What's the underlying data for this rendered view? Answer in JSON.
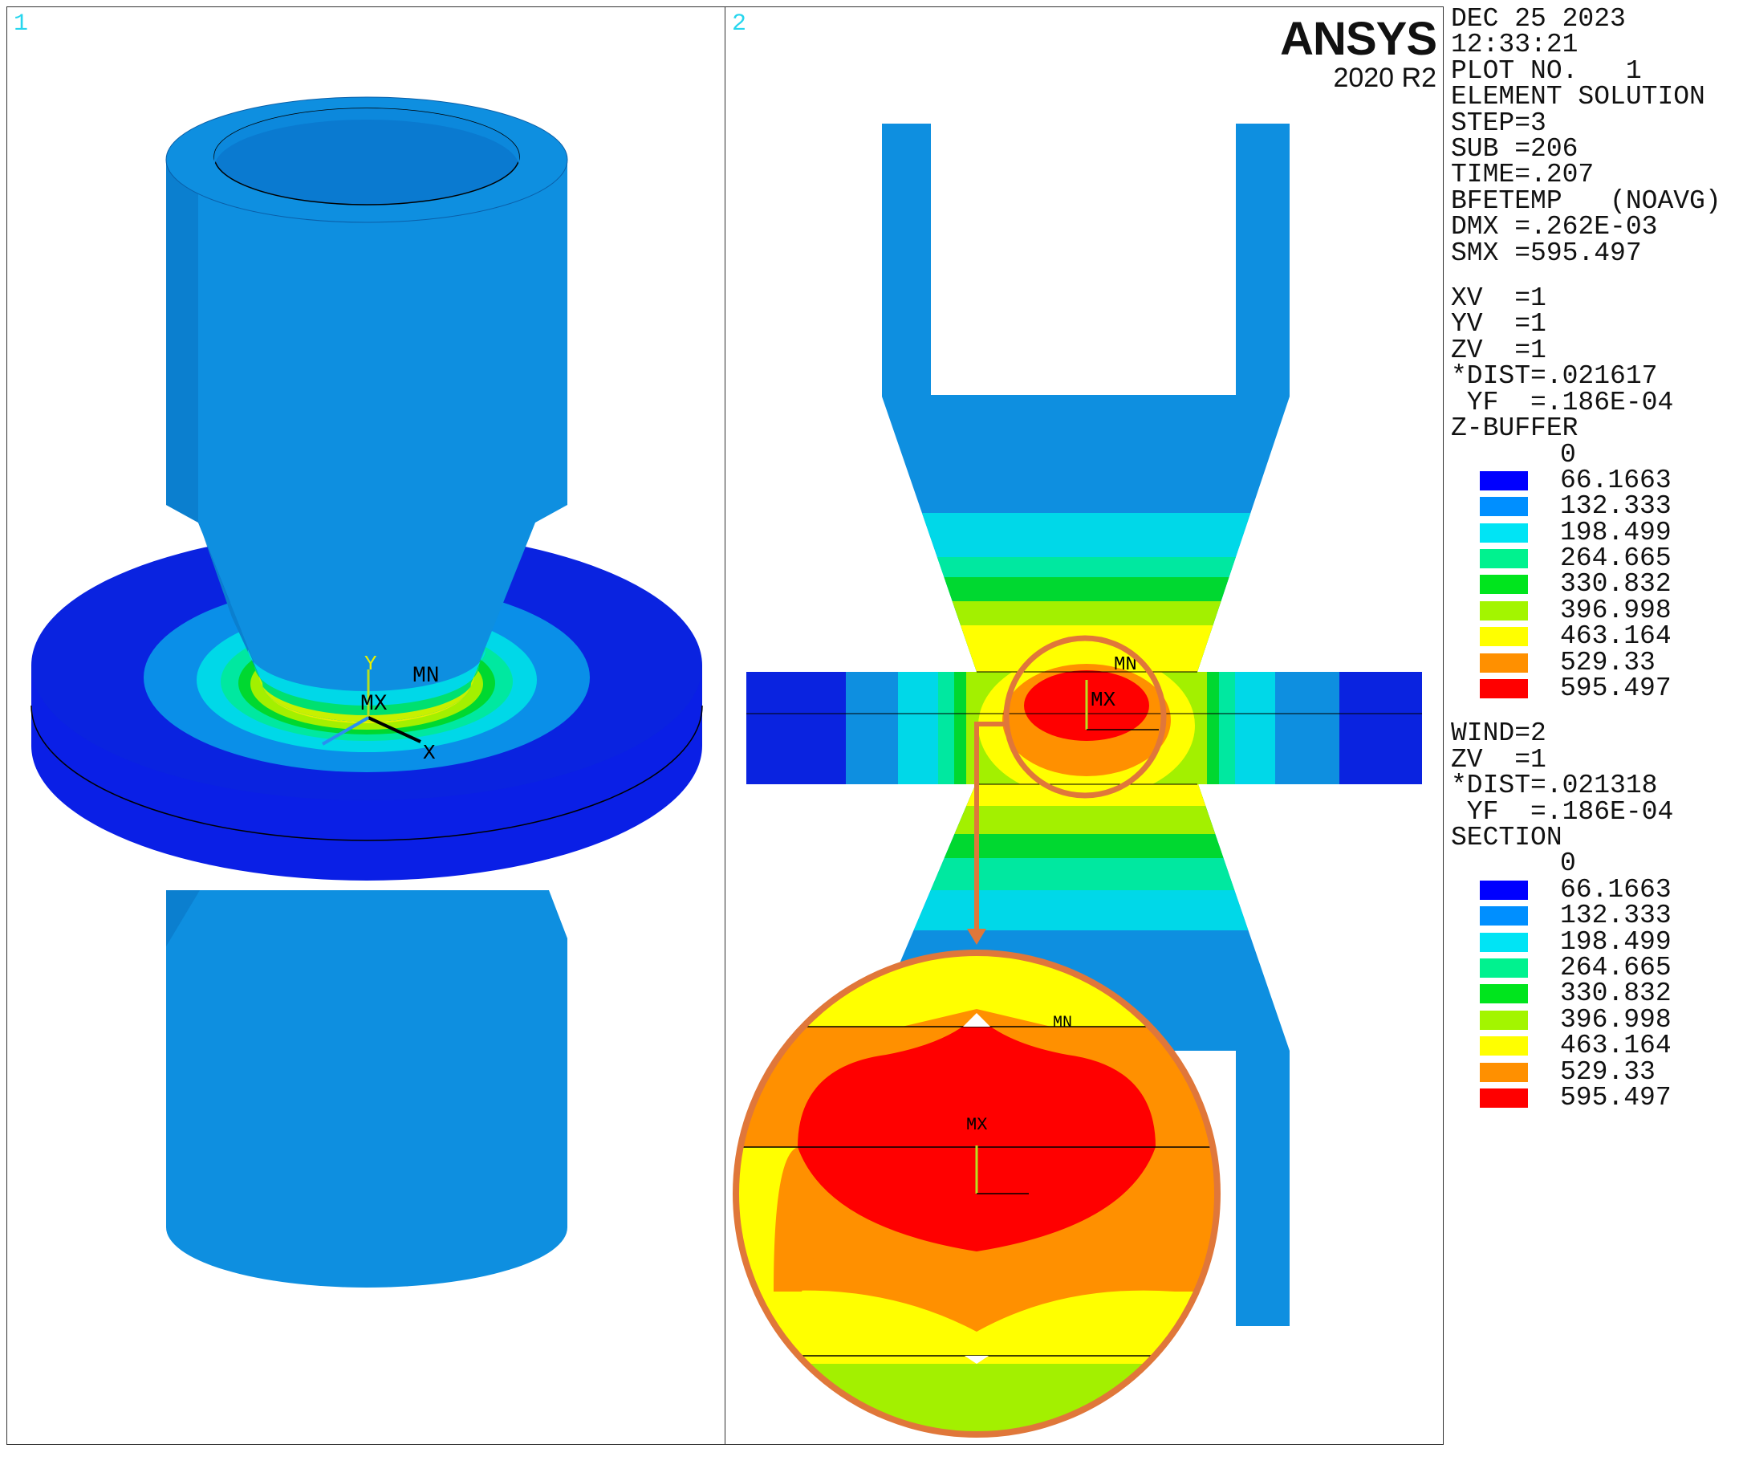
{
  "viewport1": {
    "number": "1"
  },
  "viewport2": {
    "number": "2"
  },
  "logo": {
    "brand": "ANSYS",
    "version": "2020 R2"
  },
  "triad": {
    "y": "Y",
    "x": "X",
    "mn": "MN",
    "mx": "MX"
  },
  "info": {
    "lines": [
      "DEC 25 2023",
      "12:33:21",
      "PLOT NO.   1",
      "ELEMENT SOLUTION",
      "STEP=3",
      "SUB =206",
      "TIME=.207",
      "BFETEMP   (NOAVG)",
      "DMX =.262E-03",
      "SMX =595.497"
    ],
    "window1": [
      "XV  =1",
      "YV  =1",
      "ZV  =1",
      "*DIST=.021617",
      " YF  =.186E-04",
      "Z-BUFFER"
    ],
    "window2": [
      "WIND=2",
      "ZV  =1",
      "*DIST=.021318",
      " YF  =.186E-04",
      "SECTION"
    ]
  },
  "legend": {
    "top_value": "0",
    "values": [
      "66.1663",
      "132.333",
      "198.499",
      "264.665",
      "330.832",
      "396.998",
      "463.164",
      "529.33",
      "595.497"
    ],
    "colors": [
      "#0000ff",
      "#008fff",
      "#00e4f5",
      "#00f28f",
      "#00e51d",
      "#a3f500",
      "#ffff00",
      "#ff9000",
      "#ff0000"
    ]
  }
}
